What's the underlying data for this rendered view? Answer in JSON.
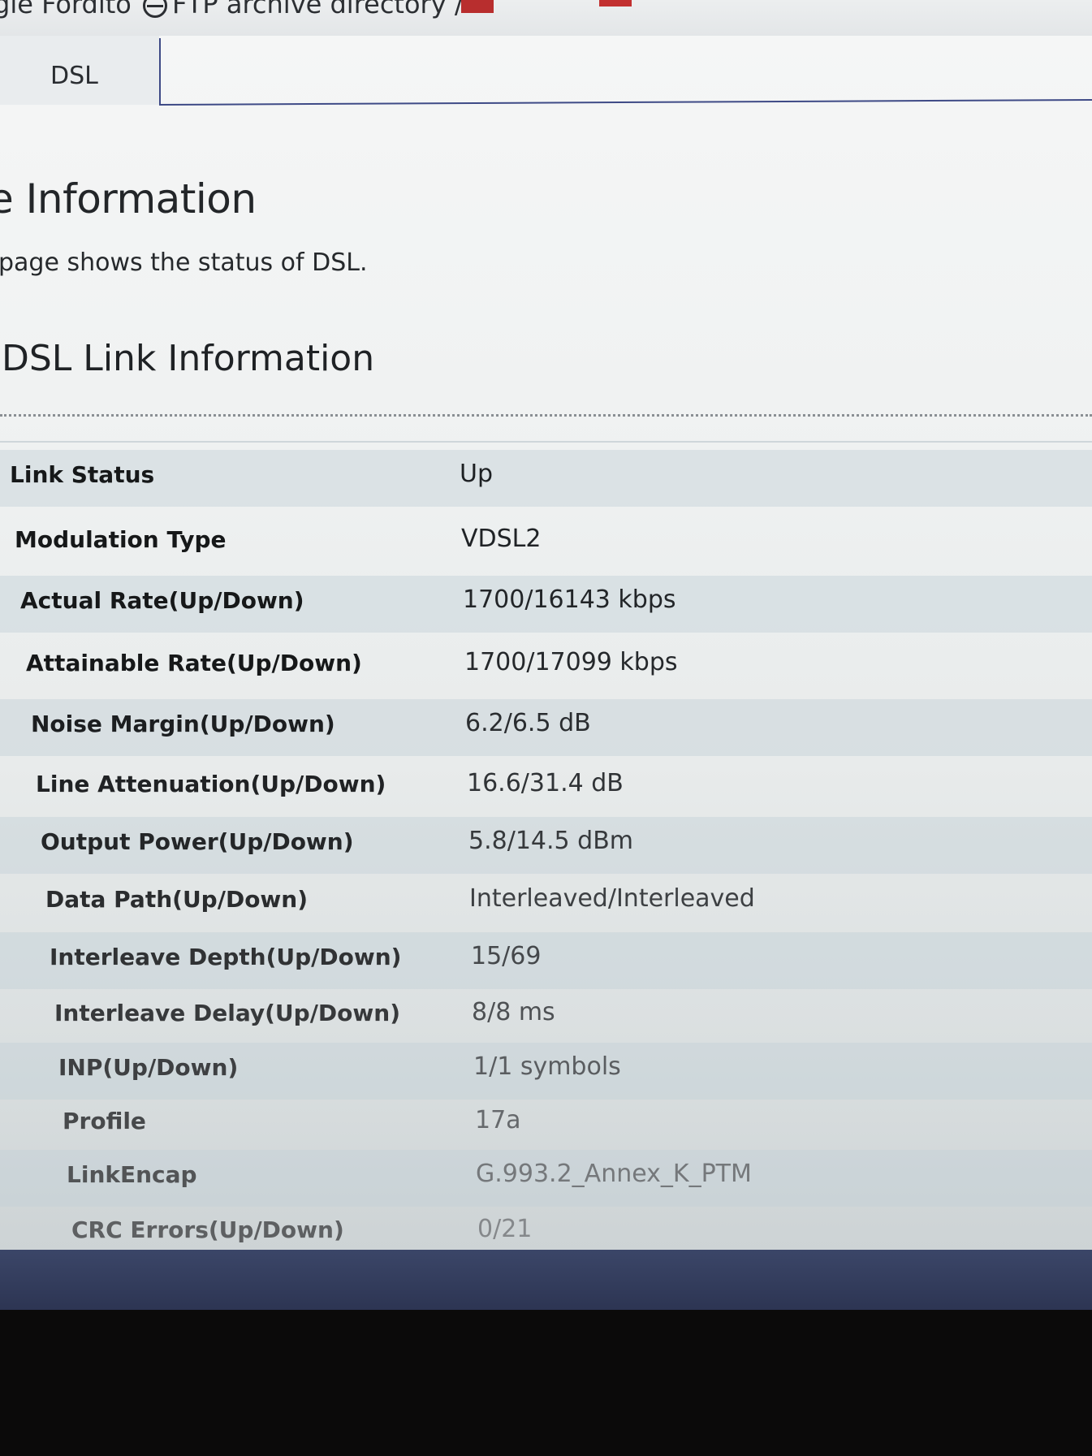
{
  "bookmarks": {
    "items": [
      {
        "label": "gle Fordító",
        "icon": "none"
      },
      {
        "label": "FTP archive directory /",
        "icon": "globe-icon"
      }
    ]
  },
  "tabs": {
    "active": "DSL"
  },
  "page": {
    "title": "e Information",
    "description": "page shows the status of DSL."
  },
  "section": {
    "title": "DSL Link Information"
  },
  "link_info": [
    {
      "label": "Link Status",
      "value": "Up"
    },
    {
      "label": "Modulation Type",
      "value": "VDSL2"
    },
    {
      "label": "Actual Rate(Up/Down)",
      "value": "1700/16143 kbps"
    },
    {
      "label": "Attainable Rate(Up/Down)",
      "value": "1700/17099 kbps"
    },
    {
      "label": "Noise Margin(Up/Down)",
      "value": "6.2/6.5 dB"
    },
    {
      "label": "Line Attenuation(Up/Down)",
      "value": "16.6/31.4 dB"
    },
    {
      "label": "Output Power(Up/Down)",
      "value": "5.8/14.5 dBm"
    },
    {
      "label": "Data Path(Up/Down)",
      "value": "Interleaved/Interleaved"
    },
    {
      "label": "Interleave Depth(Up/Down)",
      "value": "15/69"
    },
    {
      "label": "Interleave Delay(Up/Down)",
      "value": "8/8 ms"
    },
    {
      "label": "INP(Up/Down)",
      "value": "1/1 symbols"
    },
    {
      "label": "Profile",
      "value": "17a"
    },
    {
      "label": "LinkEncap",
      "value": "G.993.2_Annex_K_PTM"
    },
    {
      "label": "CRC Errors(Up/Down)",
      "value": "0/21"
    }
  ],
  "colors": {
    "tab_line": "#3e4a86",
    "footer": "#2d3553"
  }
}
